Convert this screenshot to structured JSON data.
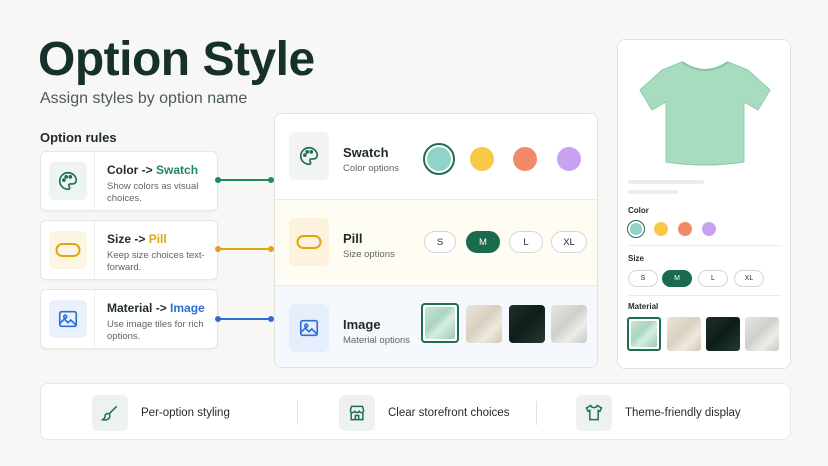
{
  "header": {
    "title": "Option Style",
    "subtitle": "Assign styles by option name"
  },
  "rules": {
    "heading": "Option rules",
    "items": [
      {
        "option": "Color",
        "arrow": " -> ",
        "style": "Swatch",
        "description": "Show colors as visual choices.",
        "icon": "palette-icon",
        "accent": "#1f8a5b"
      },
      {
        "option": "Size",
        "arrow": " -> ",
        "style": "Pill",
        "description": "Keep size choices text-forward.",
        "icon": "pill-icon",
        "accent": "#e2a413"
      },
      {
        "option": "Material",
        "arrow": " -> ",
        "style": "Image",
        "description": "Use image tiles for rich options.",
        "icon": "image-icon",
        "accent": "#2d6fd6"
      }
    ]
  },
  "styles": {
    "swatch": {
      "name": "Swatch",
      "sub": "Color options",
      "colors": [
        "#8fd3c9",
        "#f9c846",
        "#f28a6a",
        "#c7a3f0"
      ],
      "selected_index": 0
    },
    "pill": {
      "name": "Pill",
      "sub": "Size options",
      "sizes": [
        "S",
        "M",
        "L",
        "XL"
      ],
      "selected_index": 1
    },
    "image": {
      "name": "Image",
      "sub": "Material options",
      "tiles": [
        "mint-fabric",
        "beige-knit",
        "dark-green-knit",
        "light-gray-knit"
      ],
      "selected_index": 0
    }
  },
  "preview": {
    "product_icon": "tshirt-image",
    "color_label": "Color",
    "size_label": "Size",
    "material_label": "Material",
    "sizes": [
      "S",
      "M",
      "L",
      "XL"
    ],
    "colors": [
      "#8fd3c9",
      "#f9c846",
      "#f28a6a",
      "#c7a3f0"
    ]
  },
  "features": [
    {
      "label": "Per-option styling",
      "icon": "brush-icon"
    },
    {
      "label": "Clear storefront choices",
      "icon": "storefront-icon"
    },
    {
      "label": "Theme-friendly display",
      "icon": "shirt-icon"
    }
  ],
  "colors": {
    "brand_green": "#1a6b4d",
    "swatch_accent": "#1f8a5b",
    "pill_accent": "#e2a413",
    "image_accent": "#2d6fd6"
  }
}
